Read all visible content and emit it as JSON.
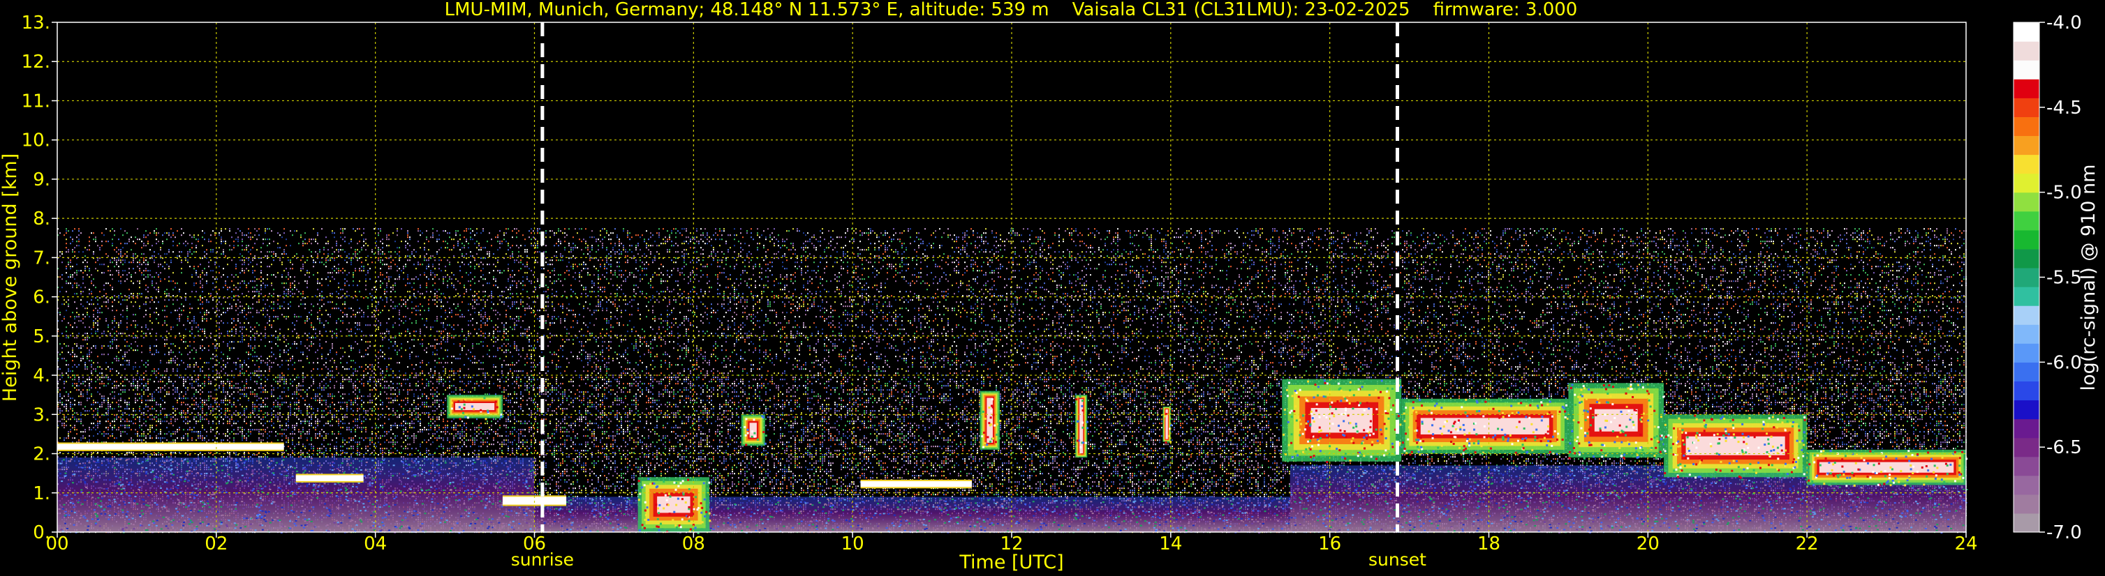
{
  "chart_data": {
    "type": "heatmap",
    "title": "LMU-MIM, Munich, Germany; 48.148° N 11.573° E, altitude: 539 m    Vaisala CL31 (CL31LMU): 23-02-2025    firmware: 3.000",
    "xlabel": "Time [UTC]",
    "ylabel": "Height above ground [km]",
    "colorbar_label": "log(rc-signal) @ 910 nm",
    "xlim": [
      0,
      24
    ],
    "ylim": [
      0,
      13
    ],
    "clim": [
      -7.0,
      -4.0
    ],
    "x_ticks": [
      0,
      2,
      4,
      6,
      8,
      10,
      12,
      14,
      16,
      18,
      20,
      22,
      24
    ],
    "x_tick_labels": [
      "00",
      "02",
      "04",
      "06",
      "08",
      "10",
      "12",
      "14",
      "16",
      "18",
      "20",
      "22",
      "24"
    ],
    "y_ticks": [
      0,
      1,
      2,
      3,
      4,
      5,
      6,
      7,
      8,
      9,
      10,
      11,
      12,
      13
    ],
    "y_tick_labels": [
      "0.",
      "1.",
      "2.",
      "3.",
      "4.",
      "5.",
      "6.",
      "7.",
      "8.",
      "9.",
      "10.",
      "11.",
      "12.",
      "13."
    ],
    "colorbar_ticks": [
      -7.0,
      -6.5,
      -6.0,
      -5.5,
      -5.0,
      -4.5,
      -4.0
    ],
    "colorbar_tick_labels": [
      "-7.0",
      "-6.5",
      "-6.0",
      "-5.5",
      "-5.0",
      "-4.5",
      "-4.0"
    ],
    "colorbar_colors": [
      "#a89aa8",
      "#a07ca0",
      "#9868a0",
      "#8a4a96",
      "#7a2a88",
      "#6a1a90",
      "#1a10c8",
      "#2a48e8",
      "#3a70f0",
      "#5a98f8",
      "#80b8fa",
      "#a8d0f8",
      "#30c0a0",
      "#20a878",
      "#109848",
      "#18b830",
      "#40d040",
      "#90e040",
      "#e0f030",
      "#f8e030",
      "#f8a020",
      "#f87010",
      "#f04010",
      "#e00010",
      "#fcfcfc",
      "#f0dcdc",
      "#ffffff"
    ],
    "grid": true,
    "grid_color": "#cccc00",
    "markers": [
      {
        "label": "sunrise",
        "time": 6.1
      },
      {
        "label": "sunset",
        "time": 16.85
      }
    ],
    "signal_top_km": 7.75,
    "features": [
      {
        "kind": "aerosol-layer",
        "t_start": 0.0,
        "t_end": 6.0,
        "height_km": [
          0.0,
          1.9
        ]
      },
      {
        "kind": "aerosol-layer",
        "t_start": 6.0,
        "t_end": 15.5,
        "height_km": [
          0.0,
          0.9
        ]
      },
      {
        "kind": "aerosol-layer",
        "t_start": 15.5,
        "t_end": 24.0,
        "height_km": [
          0.0,
          1.7
        ]
      },
      {
        "kind": "cloud",
        "t_start": 0.0,
        "t_end": 2.85,
        "height_km": [
          2.1,
          2.25
        ]
      },
      {
        "kind": "cloud",
        "t_start": 3.0,
        "t_end": 3.85,
        "height_km": [
          1.3,
          1.45
        ]
      },
      {
        "kind": "cloud",
        "t_start": 4.9,
        "t_end": 5.6,
        "height_km": [
          2.9,
          3.5
        ]
      },
      {
        "kind": "cloud",
        "t_start": 5.6,
        "t_end": 6.4,
        "height_km": [
          0.7,
          0.9
        ]
      },
      {
        "kind": "cloud",
        "t_start": 7.3,
        "t_end": 8.2,
        "height_km": [
          0.0,
          1.4
        ]
      },
      {
        "kind": "cloud",
        "t_start": 8.6,
        "t_end": 8.9,
        "height_km": [
          2.2,
          3.0
        ]
      },
      {
        "kind": "cloud",
        "t_start": 10.1,
        "t_end": 11.5,
        "height_km": [
          1.15,
          1.3
        ]
      },
      {
        "kind": "cloud",
        "t_start": 11.6,
        "t_end": 11.85,
        "height_km": [
          2.1,
          3.6
        ]
      },
      {
        "kind": "cloud",
        "t_start": 12.8,
        "t_end": 12.95,
        "height_km": [
          1.9,
          3.5
        ]
      },
      {
        "kind": "cloud",
        "t_start": 13.9,
        "t_end": 14.0,
        "height_km": [
          2.3,
          3.2
        ]
      },
      {
        "kind": "cloud",
        "t_start": 15.4,
        "t_end": 16.9,
        "height_km": [
          1.8,
          3.9
        ]
      },
      {
        "kind": "cloud",
        "t_start": 16.9,
        "t_end": 19.0,
        "height_km": [
          2.0,
          3.4
        ]
      },
      {
        "kind": "cloud",
        "t_start": 19.0,
        "t_end": 20.2,
        "height_km": [
          1.9,
          3.8
        ]
      },
      {
        "kind": "cloud",
        "t_start": 20.2,
        "t_end": 22.0,
        "height_km": [
          1.4,
          3.0
        ]
      },
      {
        "kind": "cloud",
        "t_start": 22.0,
        "t_end": 24.0,
        "height_km": [
          1.2,
          2.1
        ]
      }
    ]
  }
}
